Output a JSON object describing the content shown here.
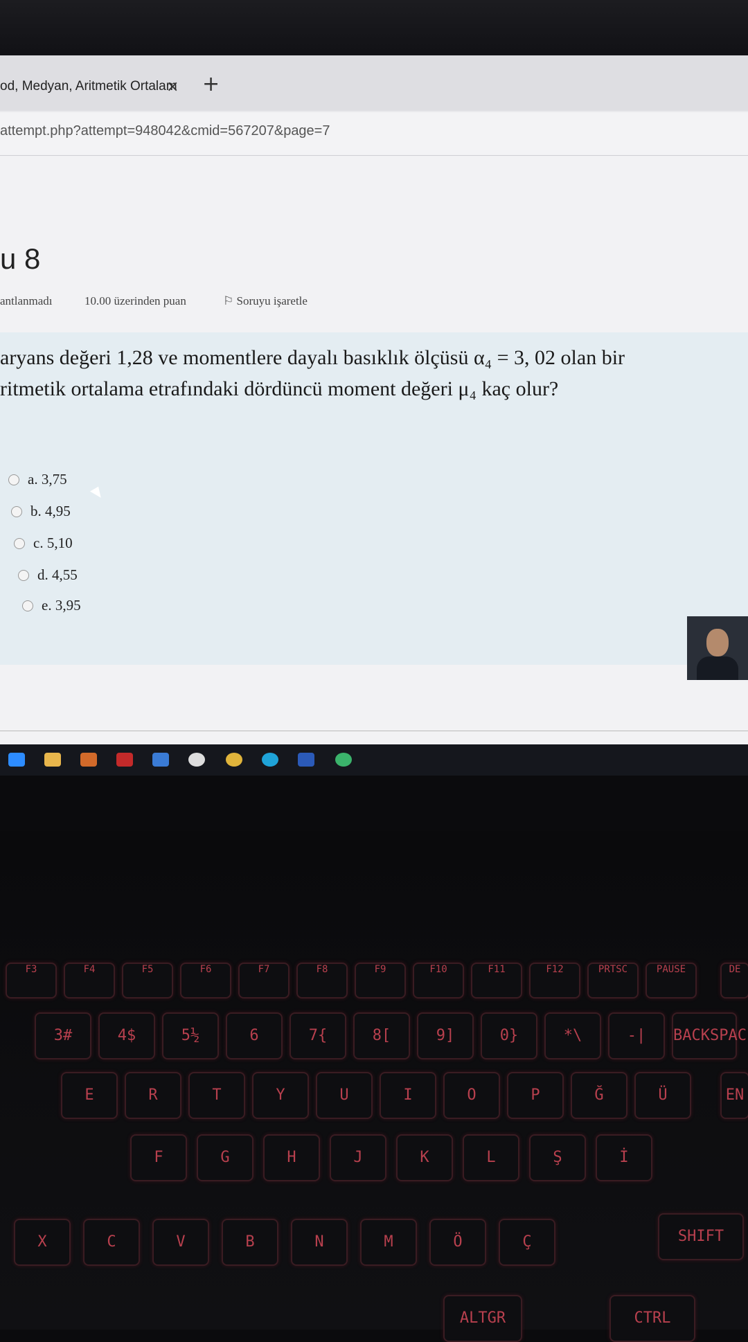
{
  "browser": {
    "tab_title": "od, Medyan, Aritmetik Ortalam",
    "tab_close": "×",
    "new_tab": "+",
    "url": "attempt.php?attempt=948042&cmid=567207&page=7"
  },
  "question": {
    "number": "u 8",
    "status": "antlanmadı",
    "points": "10.00 üzerinden puan",
    "flag": "Soruyu işaretle",
    "text_line1": "aryans değeri 1,28 ve momentlere dayalı basıklık ölçüsü α₄ = 3, 02  olan bir",
    "text_line2": "ritmetik ortalama etrafındaki dördüncü moment değeri μ₄  kaç olur?",
    "options": [
      {
        "label": "a. 3,75"
      },
      {
        "label": "b. 4,95"
      },
      {
        "label": "c. 5,10"
      },
      {
        "label": "d. 4,55"
      },
      {
        "label": "e. 3,95"
      }
    ]
  },
  "keyboard": {
    "fkeys": [
      "F3",
      "F4",
      "F5",
      "F6",
      "F7",
      "F8",
      "F9",
      "F10",
      "F11",
      "F12",
      "PRTSC",
      "PAUSE"
    ],
    "num_row": [
      "3#",
      "4$",
      "5½",
      "6",
      "7{",
      "8[",
      "9]",
      "0}",
      "*\\",
      "-|",
      "BACKSPAC"
    ],
    "qwerty_row": [
      "E",
      "R",
      "T",
      "Y",
      "U",
      "I",
      "O",
      "P",
      "Ğ",
      "Ü"
    ],
    "home_row": [
      "F",
      "G",
      "H",
      "J",
      "K",
      "L",
      "Ş",
      "İ"
    ],
    "bottom_row": [
      "X",
      "C",
      "V",
      "B",
      "N",
      "M",
      "Ö",
      "Ç"
    ],
    "labels": {
      "shift": "SHIFT",
      "altgr": "ALTGR",
      "ctrl": "CTRL",
      "enter": "EN",
      "del": "DE"
    }
  },
  "colors": {
    "accent": "#b8404e",
    "question_bg": "#e4edf2"
  }
}
